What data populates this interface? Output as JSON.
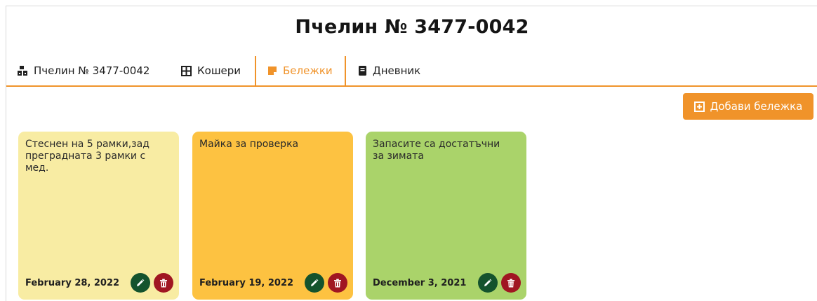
{
  "page": {
    "title": "Пчелин № 3477-0042"
  },
  "tabs": [
    {
      "label": "Пчелин № 3477-0042",
      "icon": "apiary-icon"
    },
    {
      "label": "Кошери",
      "icon": "grid-icon"
    },
    {
      "label": "Бележки",
      "icon": "note-icon",
      "active": true
    },
    {
      "label": "Дневник",
      "icon": "book-icon"
    }
  ],
  "toolbar": {
    "add_note_label": "Добави бележка"
  },
  "notes": [
    {
      "text": "Стеснен на 5 рамки,зад преградната 3 рамки с мед.",
      "date": "February 28, 2022",
      "color": "#f8eca3"
    },
    {
      "text": "Майка за проверка",
      "date": "February 19, 2022",
      "color": "#fdc241"
    },
    {
      "text": "Запасите са достатъчни за зимата",
      "date": "December 3, 2021",
      "color": "#aad36a"
    }
  ],
  "colors": {
    "accent": "#f0932a",
    "edit": "#14532d",
    "delete": "#a01622"
  }
}
